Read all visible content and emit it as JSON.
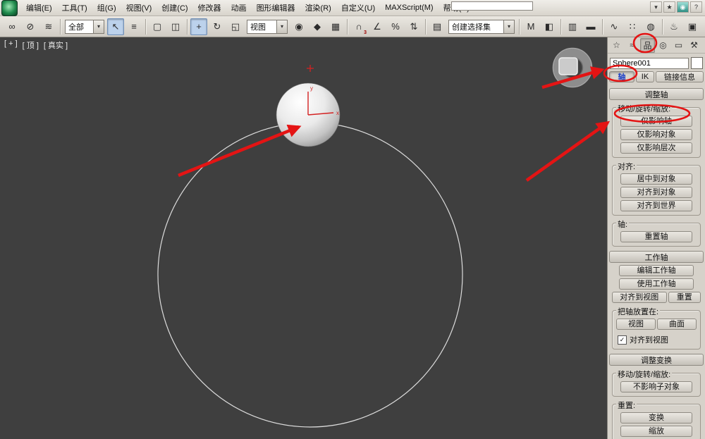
{
  "accent": {
    "annotation_red": "#e41414",
    "selected_text_blue": "#1c3fc4"
  },
  "titlebar": {
    "search_value": "",
    "glyphs": {
      "arrow_down": "▾",
      "star": "★",
      "help": "?",
      "comm": "◉"
    }
  },
  "menubar": {
    "items": [
      "编辑(E)",
      "工具(T)",
      "组(G)",
      "视图(V)",
      "创建(C)",
      "修改器",
      "动画",
      "图形编辑器",
      "渲染(R)",
      "自定义(U)",
      "MAXScript(M)",
      "帮助(H)"
    ]
  },
  "toolbar": {
    "filter_value": "全部",
    "coord_value": "视图",
    "selset_value": "创建选择集",
    "snap_badge": "3",
    "glyphs": {
      "link": "∞",
      "unlink": "⊘",
      "bind": "≋",
      "select": "↖",
      "byname": "≡",
      "region": "▢",
      "wincross": "◫",
      "move": "+",
      "rotate": "↻",
      "scale": "◱",
      "pivot": "◉",
      "manip": "◆",
      "kbd": "▦",
      "snap": "∩",
      "angle": "∠",
      "percent": "%",
      "spinner": "⇅",
      "namedsets": "▤",
      "mirror": "M",
      "align": "◧",
      "layers": "▥",
      "ribbon": "▬",
      "curve": "∿",
      "schem": "∷",
      "mtl": "◍",
      "rsetup": "♨",
      "rframe": "▣",
      "render": "♨",
      "arrow_down": "▾"
    }
  },
  "viewport": {
    "label_plus": "[ + ]",
    "label_pov": "[ 顶 ]",
    "label_shading": "[ 真实 ]",
    "axis_x": "x",
    "axis_y": "y"
  },
  "panel": {
    "object_name": "Sphere001",
    "tab_glyphs": {
      "create": "☆",
      "modify": "≈",
      "hierarchy": "品",
      "motion": "◎",
      "display": "▭",
      "utilities": "⚒"
    },
    "subtabs": {
      "pivot": "轴",
      "ik": "IK",
      "link_info": "链接信息"
    },
    "checkbox_check": "✓",
    "adjust_pivot": {
      "title": "调整轴",
      "move_rotate_scale_label": "移动/旋转/缩放:",
      "affect_pivot_only": "仅影响轴",
      "affect_object_only": "仅影响对象",
      "affect_hierarchy_only": "仅影响层次",
      "alignment_label": "对齐:",
      "center_to_object": "居中到对象",
      "align_to_object": "对齐到对象",
      "align_to_world": "对齐到世界",
      "pivot_label": "轴:",
      "reset_pivot": "重置轴"
    },
    "working_pivot": {
      "title": "工作轴",
      "edit_working_pivot": "编辑工作轴",
      "use_working_pivot": "使用工作轴",
      "align_to_view": "对齐到视图",
      "reset": "重置",
      "place_pivot_label": "把轴放置在:",
      "view": "视图",
      "surface": "曲面",
      "align_to_view_checkbox": "对齐到视图"
    },
    "adjust_transform": {
      "title": "调整变换",
      "move_rotate_scale_label": "移动/旋转/缩放:",
      "dont_affect_children": "不影响子对象",
      "reset_label": "重置:",
      "transform": "变换",
      "scale": "缩放"
    }
  }
}
